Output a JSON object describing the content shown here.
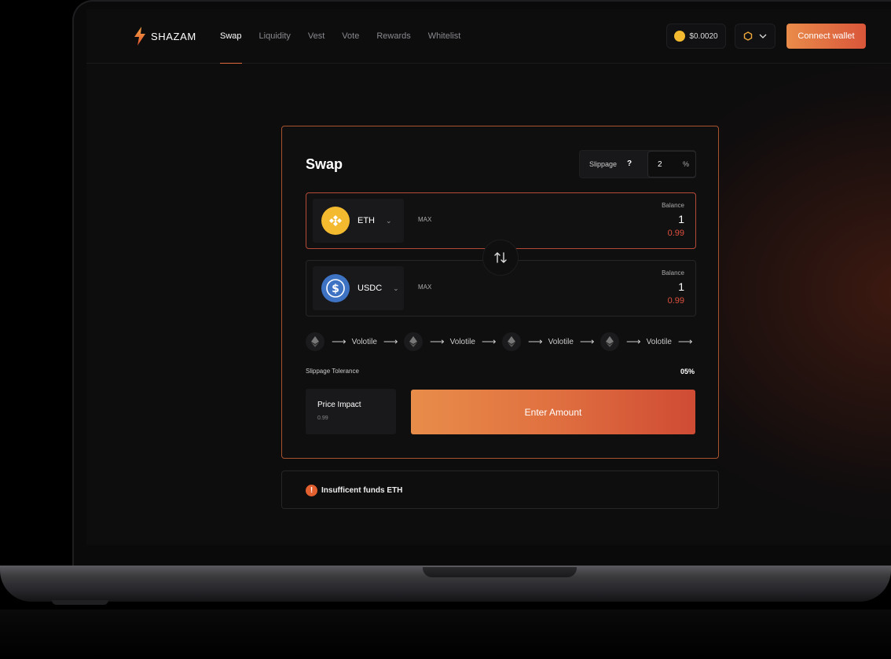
{
  "app": {
    "name": "SHAZAM"
  },
  "nav": {
    "items": [
      {
        "label": "Swap",
        "active": true
      },
      {
        "label": "Liquidity",
        "active": false
      },
      {
        "label": "Vest",
        "active": false
      },
      {
        "label": "Vote",
        "active": false
      },
      {
        "label": "Rewards",
        "active": false
      },
      {
        "label": "Whitelist",
        "active": false
      }
    ]
  },
  "header": {
    "token_price": "$0.0020",
    "connect_label": "Connect wallet"
  },
  "swap": {
    "title": "Swap",
    "slippage": {
      "label": "Slippage",
      "help": "?",
      "value": "2",
      "unit": "%"
    },
    "from": {
      "token": "ETH",
      "max_label": "MAX",
      "balance_label": "Balance",
      "balance": "1",
      "usd_value": "0.99",
      "icon": "bnb-coin-icon"
    },
    "to": {
      "token": "USDC",
      "max_label": "MAX",
      "balance_label": "Balance",
      "balance": "1",
      "usd_value": "0.99",
      "icon": "usdc-coin-icon"
    },
    "route": [
      {
        "label": "Volotile"
      },
      {
        "label": "Volotile"
      },
      {
        "label": "Volotile"
      },
      {
        "label": "Volotile"
      }
    ],
    "tolerance": {
      "label": "Slippage Tolerance",
      "value": "05%"
    },
    "impact": {
      "label": "Price Impact",
      "value": "0.99"
    },
    "enter_label": "Enter Amount"
  },
  "alert": {
    "icon": "!",
    "text": "Insufficent funds ETH"
  },
  "colors": {
    "accent": "#e26a3a",
    "danger": "#e0503d",
    "background": "#0d0d0e"
  }
}
